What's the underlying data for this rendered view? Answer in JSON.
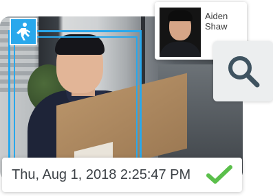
{
  "detection": {
    "event_icon": "person-walking-icon",
    "timestamp": "Thu, Aug 1, 2018 2:25:47 PM",
    "status_icon": "checkmark-icon",
    "status_color": "#5bbf4b"
  },
  "match_profile": {
    "name": "Aiden Shaw",
    "photo": "profile-photo"
  },
  "actions": {
    "search_icon": "search-icon"
  },
  "colors": {
    "accent": "#29a8ec",
    "search_icon": "#3f5360"
  }
}
